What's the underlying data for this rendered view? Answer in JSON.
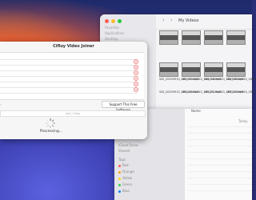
{
  "finder_top": {
    "title": "My Videos",
    "nav_back": "‹",
    "nav_forward": "›",
    "sidebar_items": [
      "Favorites",
      "Applications",
      "Desktop"
    ],
    "files": [
      "VID_20250910_183103.mp4",
      "VID_20250910_184216.mp4",
      "VID_20250910_184326.mp4",
      "VID_20250910_185024.mp4",
      "VID_20250910_185416.mp4",
      "VID_20250910_185201.mp4",
      "VID_20250910_183514.mp4",
      "VID_20250910_185416.mp4"
    ]
  },
  "finder_bottom": {
    "column_header": "Name",
    "row_app_name": "Cifluy Video Joiner",
    "row_app_kind": "Today",
    "sidebar_labels": [
      "iCloud Drive",
      "Shared",
      "Tags"
    ],
    "tags": [
      {
        "label": "Red",
        "color": "#ff5b57"
      },
      {
        "label": "Orange",
        "color": "#ff9f0a"
      },
      {
        "label": "Yellow",
        "color": "#ffd60a"
      },
      {
        "label": "Green",
        "color": "#30d158"
      },
      {
        "label": "Blue",
        "color": "#0a84ff"
      }
    ]
  },
  "app": {
    "title": "Cifluy Video Joiner",
    "support_button": "Support This Free Software",
    "add_text": "Add / Drop",
    "processing": "Processing...",
    "remove_icon": "⊖"
  }
}
